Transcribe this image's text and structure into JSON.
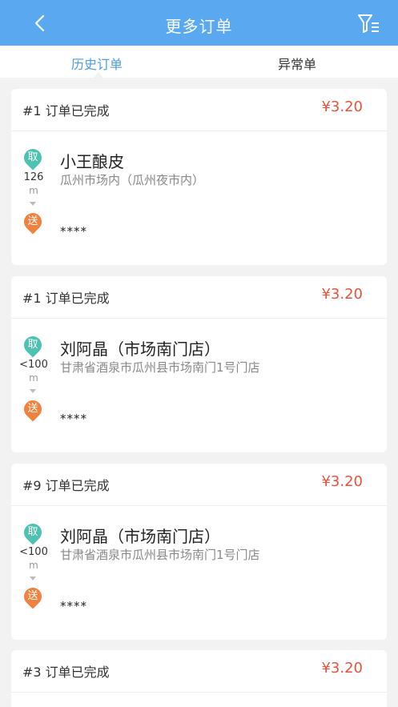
{
  "header": {
    "title": "更多订单",
    "back_icon": "chevron-left-icon",
    "filter_icon": "filter-list-icon"
  },
  "tabs": [
    {
      "label": "历史订单",
      "active": true
    },
    {
      "label": "异常单",
      "active": false
    }
  ],
  "orders": [
    {
      "status": "#1 订单已完成",
      "price": "¥3.20",
      "pickup_label": "取",
      "distance": "126",
      "distance_unit": "m",
      "store_name": "小王酿皮",
      "store_address": "瓜州市场内（瓜州夜市内）",
      "drop_label": "送",
      "customer": "****"
    },
    {
      "status": "#1 订单已完成",
      "price": "¥3.20",
      "pickup_label": "取",
      "distance": "<100",
      "distance_unit": "m",
      "store_name": "刘阿晶（市场南门店）",
      "store_address": "甘肃省酒泉市瓜州县市场南门1号门店",
      "drop_label": "送",
      "customer": "****"
    },
    {
      "status": "#9 订单已完成",
      "price": "¥3.20",
      "pickup_label": "取",
      "distance": "<100",
      "distance_unit": "m",
      "store_name": "刘阿晶（市场南门店）",
      "store_address": "甘肃省酒泉市瓜州县市场南门1号门店",
      "drop_label": "送",
      "customer": "****"
    },
    {
      "status": "#3 订单已完成",
      "price": "¥3.20"
    }
  ],
  "colors": {
    "header_bg": "#5aa9f0",
    "active_tab": "#4a9de8",
    "price": "#e7533c",
    "pickup": "#4dc2b3",
    "drop": "#f0813f"
  }
}
